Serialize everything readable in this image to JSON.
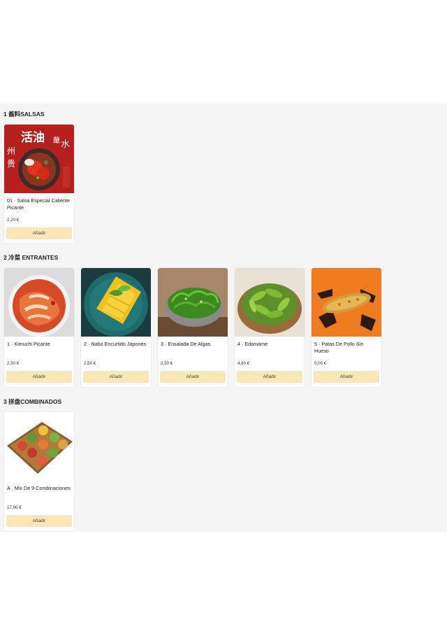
{
  "sections": [
    {
      "title": "1 酱料SALSAS",
      "items": [
        {
          "name": "01 · Salsa Especial Caliente Picante",
          "price": "2,20 €",
          "add": "Añadir"
        }
      ]
    },
    {
      "title": "2 冷菜 ENTRANTES",
      "items": [
        {
          "name": "1 · Kimuchi Picante",
          "price": "2,50 €",
          "add": "Añadir"
        },
        {
          "name": "2 · Nabo Encurtido Japones",
          "price": "2,50 €",
          "add": "Añadir"
        },
        {
          "name": "3 · Ensalada De Algas",
          "price": "2,50 €",
          "add": "Añadir"
        },
        {
          "name": "4 · Edamame",
          "price": "4,80 €",
          "add": "Añadir"
        },
        {
          "name": "5 · Patas De Pollo Sin Hueso",
          "price": "5,00 €",
          "add": "Añadir"
        }
      ]
    },
    {
      "title": "3 拼盘COMBINADOS",
      "items": [
        {
          "name": "A · Mix De 9 Combinaciones",
          "price": "17,90 €",
          "add": "Añadir"
        }
      ]
    }
  ],
  "logo_text": "活油蘸水贵州"
}
